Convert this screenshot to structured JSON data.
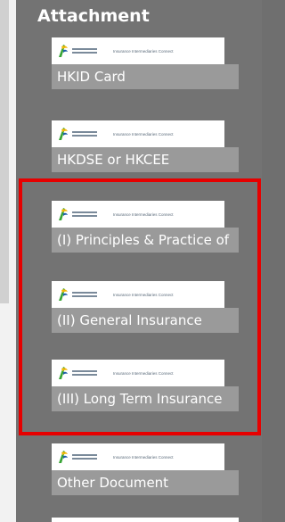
{
  "section": {
    "title": "Attachment"
  },
  "attachments": [
    {
      "banner_text": "Insurance Intermediaries Connect",
      "label": "HKID Card"
    },
    {
      "banner_text": "Insurance Intermediaries Connect",
      "label": "HKDSE or HKCEE"
    },
    {
      "banner_text": "Insurance Intermediaries Connect",
      "label": "(I) Principles & Practice of"
    },
    {
      "banner_text": "Insurance Intermediaries Connect",
      "label": "(II) General Insurance"
    },
    {
      "banner_text": "Insurance Intermediaries Connect",
      "label": "(III) Long Term Insurance"
    },
    {
      "banner_text": "Insurance Intermediaries Connect",
      "label": "Other Document"
    }
  ],
  "colors": {
    "highlight": "#e60000",
    "panel": "#737373",
    "label_bg": "#9a9a9a"
  },
  "icons": {
    "logo": "ia-logo-icon"
  }
}
